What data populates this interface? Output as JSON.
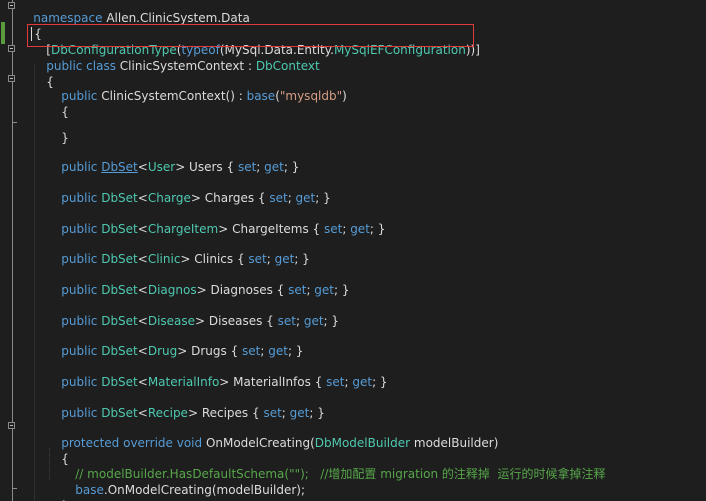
{
  "editor": {
    "background": "#1e1e1e",
    "highlight_color": "#e03a3a",
    "lines": {
      "l1": {
        "kw1": "namespace",
        "rest": " Allen.ClinicSystem.Data"
      },
      "l2": {
        "text": "{"
      },
      "l3": {
        "p1": "[",
        "ty1": "DbConfigurationType",
        "p2": "(",
        "kw1": "typeof",
        "p3": "(MySql.Data.Entity.",
        "ty2": "MySqlEFConfiguration",
        "p4": "))]"
      },
      "l4": {
        "kw1": "public class",
        "p1": " ClinicSystemContext : ",
        "ty1": "DbContext"
      },
      "l5": {
        "text": "{"
      },
      "l6": {
        "kw1": "public",
        "p1": " ClinicSystemContext() : ",
        "kw2": "base",
        "p2": "(",
        "st1": "\"mysqldb\"",
        "p3": ")"
      },
      "l7": {
        "text": "{"
      },
      "l8": {
        "text": "}"
      },
      "l9": {
        "kw1": "public",
        "hl1": "DbSet",
        "p1": "<",
        "ty1": "User",
        "p2": "> Users { ",
        "kw2": "set",
        "p3": "; ",
        "kw3": "get",
        "p4": "; }"
      },
      "l10": {
        "kw1": "public",
        "ty1": "DbSet",
        "p1": "<",
        "ty2": "Charge",
        "p2": "> Charges { ",
        "kw2": "set",
        "p3": "; ",
        "kw3": "get",
        "p4": "; }"
      },
      "l11": {
        "kw1": "public",
        "ty1": "DbSet",
        "p1": "<",
        "ty2": "ChargeItem",
        "p2": "> ChargeItems { ",
        "kw2": "set",
        "p3": "; ",
        "kw3": "get",
        "p4": "; }"
      },
      "l12": {
        "kw1": "public",
        "ty1": "DbSet",
        "p1": "<",
        "ty2": "Clinic",
        "p2": "> Clinics { ",
        "kw2": "set",
        "p3": "; ",
        "kw3": "get",
        "p4": "; }"
      },
      "l13": {
        "kw1": "public",
        "ty1": "DbSet",
        "p1": "<",
        "ty2": "Diagnos",
        "p2": "> Diagnoses { ",
        "kw2": "set",
        "p3": "; ",
        "kw3": "get",
        "p4": "; }"
      },
      "l14": {
        "kw1": "public",
        "ty1": "DbSet",
        "p1": "<",
        "ty2": "Disease",
        "p2": "> Diseases { ",
        "kw2": "set",
        "p3": "; ",
        "kw3": "get",
        "p4": "; }"
      },
      "l15": {
        "kw1": "public",
        "ty1": "DbSet",
        "p1": "<",
        "ty2": "Drug",
        "p2": "> Drugs { ",
        "kw2": "set",
        "p3": "; ",
        "kw3": "get",
        "p4": "; }"
      },
      "l16": {
        "kw1": "public",
        "ty1": "DbSet",
        "p1": "<",
        "ty2": "MaterialInfo",
        "p2": "> MaterialInfos { ",
        "kw2": "set",
        "p3": "; ",
        "kw3": "get",
        "p4": "; }"
      },
      "l17": {
        "kw1": "public",
        "ty1": "DbSet",
        "p1": "<",
        "ty2": "Recipe",
        "p2": "> Recipes { ",
        "kw2": "set",
        "p3": "; ",
        "kw3": "get",
        "p4": "; }"
      },
      "l18": {
        "kw1": "protected override void",
        "p1": " OnModelCreating(",
        "ty1": "DbModelBuilder",
        "p2": " modelBuilder)"
      },
      "l19": {
        "text": "{"
      },
      "l20": {
        "cm1": "// modelBuilder.HasDefaultSchema(\"\");   //增加配置 migration 的注释掉  运行的时候拿掉注释"
      },
      "l21": {
        "kw1": "base",
        "p1": ".OnModelCreating(modelBuilder);"
      },
      "l22": {
        "text": "}"
      }
    }
  }
}
